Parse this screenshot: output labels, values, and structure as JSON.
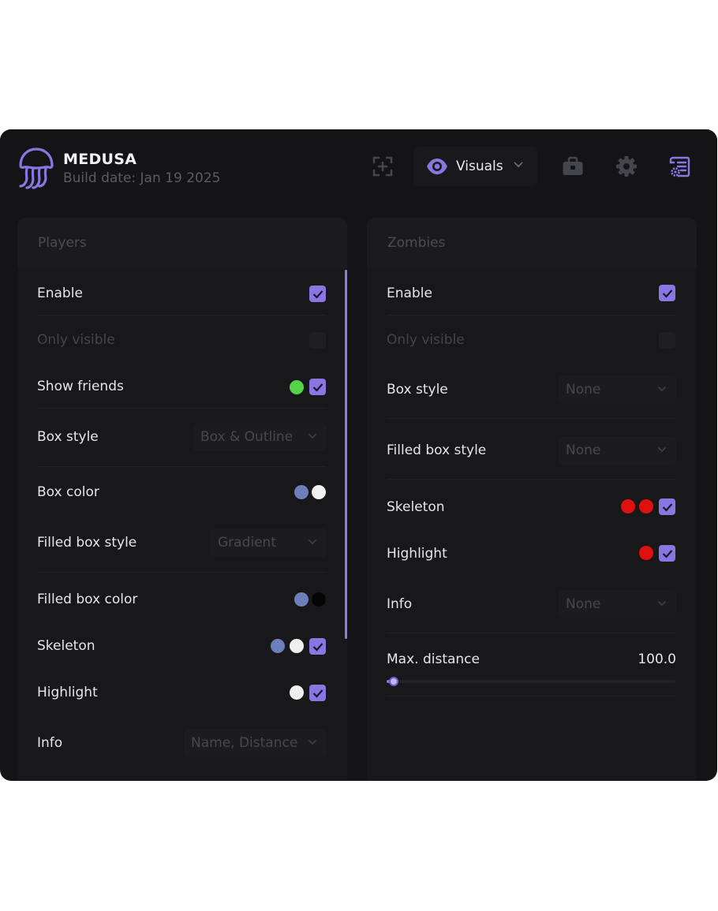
{
  "app": {
    "name": "MEDUSA",
    "build_date": "Build date: Jan 19 2025"
  },
  "header": {
    "tab_label": "Visuals",
    "icons": [
      "add-target-icon",
      "eye-icon",
      "chevron-down-icon",
      "briefcase-icon",
      "gear-icon",
      "script-settings-icon"
    ]
  },
  "colors": {
    "accent": "#8a76e0",
    "background": "#141416",
    "panel": "#18181b",
    "green": "#55d44a",
    "blue": "#6c7fbb",
    "white": "#f0f0f0",
    "black": "#050505",
    "red": "#e01010"
  },
  "players": {
    "title": "Players",
    "enable": {
      "label": "Enable",
      "checked": true
    },
    "only_visible": {
      "label": "Only visible",
      "checked": false,
      "disabled": true
    },
    "show_friends": {
      "label": "Show friends",
      "checked": true,
      "colors": [
        "#55d44a"
      ]
    },
    "box_style": {
      "label": "Box style",
      "value": "Box & Outline"
    },
    "box_color": {
      "label": "Box color",
      "colors": [
        "#6c7fbb",
        "#f0f0f0"
      ]
    },
    "filled_box_style": {
      "label": "Filled box style",
      "value": "Gradient"
    },
    "filled_box_color": {
      "label": "Filled box color",
      "colors": [
        "#6c7fbb",
        "#050505"
      ]
    },
    "skeleton": {
      "label": "Skeleton",
      "checked": true,
      "colors": [
        "#6c7fbb",
        "#f0f0f0"
      ]
    },
    "highlight": {
      "label": "Highlight",
      "checked": true,
      "colors": [
        "#f0f0f0"
      ]
    },
    "info": {
      "label": "Info",
      "value": "Name, Distance"
    }
  },
  "zombies": {
    "title": "Zombies",
    "enable": {
      "label": "Enable",
      "checked": true
    },
    "only_visible": {
      "label": "Only visible",
      "checked": false,
      "disabled": true
    },
    "box_style": {
      "label": "Box style",
      "value": "None"
    },
    "filled_box_style": {
      "label": "Filled box style",
      "value": "None"
    },
    "skeleton": {
      "label": "Skeleton",
      "checked": true,
      "colors": [
        "#e01010",
        "#e01010"
      ]
    },
    "highlight": {
      "label": "Highlight",
      "checked": true,
      "colors": [
        "#e01010"
      ]
    },
    "info": {
      "label": "Info",
      "value": "None"
    },
    "max_distance": {
      "label": "Max. distance",
      "value": "100.0",
      "fraction": 0.02
    }
  }
}
